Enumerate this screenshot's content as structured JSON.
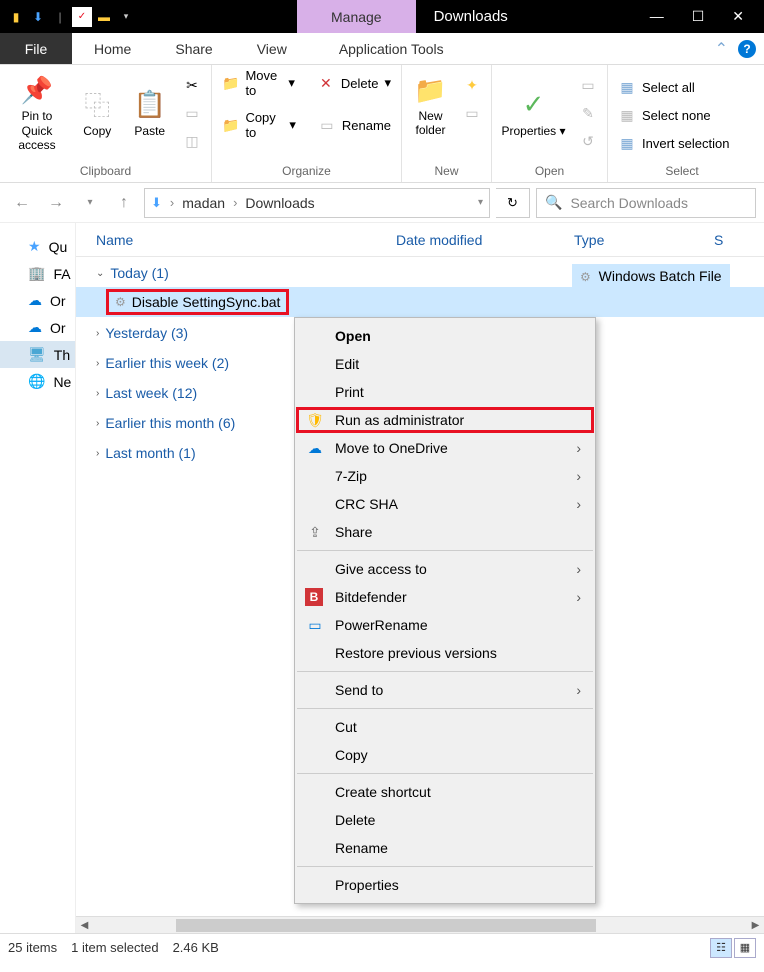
{
  "title": "Downloads",
  "manage_tab": "Manage",
  "tabs": {
    "file": "File",
    "home": "Home",
    "share": "Share",
    "view": "View",
    "apptools": "Application Tools"
  },
  "ribbon": {
    "clipboard": {
      "label": "Clipboard",
      "pin": "Pin to Quick access",
      "copy": "Copy",
      "paste": "Paste"
    },
    "organize": {
      "label": "Organize",
      "moveto": "Move to",
      "copyto": "Copy to",
      "delete": "Delete",
      "rename": "Rename"
    },
    "new": {
      "label": "New",
      "newfolder": "New folder"
    },
    "open": {
      "label": "Open",
      "properties": "Properties"
    },
    "select": {
      "label": "Select",
      "all": "Select all",
      "none": "Select none",
      "invert": "Invert selection"
    }
  },
  "breadcrumb": {
    "p1": "madan",
    "p2": "Downloads"
  },
  "search_placeholder": "Search Downloads",
  "columns": {
    "name": "Name",
    "date": "Date modified",
    "type": "Type",
    "size": "S"
  },
  "sidebar": [
    "Qu",
    "FA",
    "Or",
    "Or",
    "Th",
    "Ne"
  ],
  "groups": [
    {
      "label": "Today (1)",
      "expanded": true
    },
    {
      "label": "Yesterday (3)"
    },
    {
      "label": "Earlier this week (2)"
    },
    {
      "label": "Last week (12)"
    },
    {
      "label": "Earlier this month (6)"
    },
    {
      "label": "Last month (1)"
    }
  ],
  "selected_file": "Disable SettingSync.bat",
  "selected_type": "Windows Batch File",
  "ctx": {
    "open": "Open",
    "edit": "Edit",
    "print": "Print",
    "runas": "Run as administrator",
    "onedrive": "Move to OneDrive",
    "sevenzip": "7-Zip",
    "crcsha": "CRC SHA",
    "share": "Share",
    "giveaccess": "Give access to",
    "bitdefender": "Bitdefender",
    "powerrename": "PowerRename",
    "restore": "Restore previous versions",
    "sendto": "Send to",
    "cut": "Cut",
    "copy": "Copy",
    "shortcut": "Create shortcut",
    "delete": "Delete",
    "rename": "Rename",
    "properties": "Properties"
  },
  "status": {
    "items": "25 items",
    "selected": "1 item selected",
    "size": "2.46 KB"
  }
}
